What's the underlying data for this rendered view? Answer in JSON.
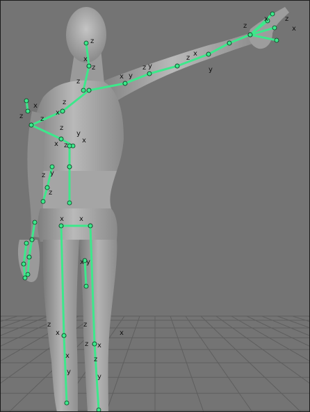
{
  "viewport": {
    "background_color": "#747474",
    "grid_color": "#5e5e5e",
    "skin_color": "#a6a6a6",
    "bone_color": "#3de88b",
    "bone_outline_color": "#0a3a1f"
  },
  "axis_labels": {
    "x": "x",
    "y": "y",
    "z": "z"
  }
}
